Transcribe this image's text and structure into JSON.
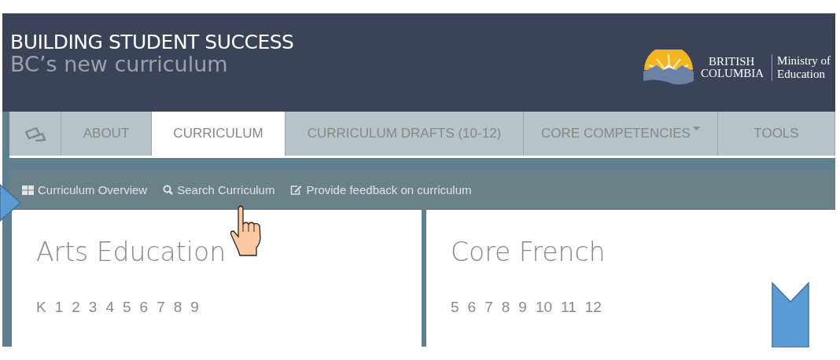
{
  "header": {
    "title": "BUILDING STUDENT SUCCESS",
    "subtitle": "BC’s new curriculum",
    "logo": {
      "line_1": "BRITISH",
      "line_2": "COLUMBIA",
      "ministry_1": "Ministry of",
      "ministry_2": "Education"
    }
  },
  "nav_tabs": [
    {
      "kind": "icon",
      "selected": false
    },
    {
      "kind": "text",
      "label": "ABOUT",
      "selected": false
    },
    {
      "kind": "text",
      "label": "CURRICULUM",
      "selected": true
    },
    {
      "kind": "text",
      "label": "CURRICULUM DRAFTS (10-12)",
      "selected": false
    },
    {
      "kind": "dropdown",
      "label": "CORE COMPETENCIES",
      "selected": false
    },
    {
      "kind": "text",
      "label": "TOOLS",
      "selected": false
    }
  ],
  "sub_nav": [
    {
      "kind": "grid",
      "label": "Curriculum Overview"
    },
    {
      "kind": "search",
      "label": "Search Curriculum"
    },
    {
      "kind": "edit",
      "label": "Provide feedback on curriculum"
    }
  ],
  "cards": [
    {
      "title": "Arts Education",
      "grades": [
        "K",
        "1",
        "2",
        "3",
        "4",
        "5",
        "6",
        "7",
        "8",
        "9"
      ]
    },
    {
      "title": "Core French",
      "grades": [
        "5",
        "6",
        "7",
        "8",
        "9",
        "10",
        "11",
        "12"
      ]
    }
  ]
}
